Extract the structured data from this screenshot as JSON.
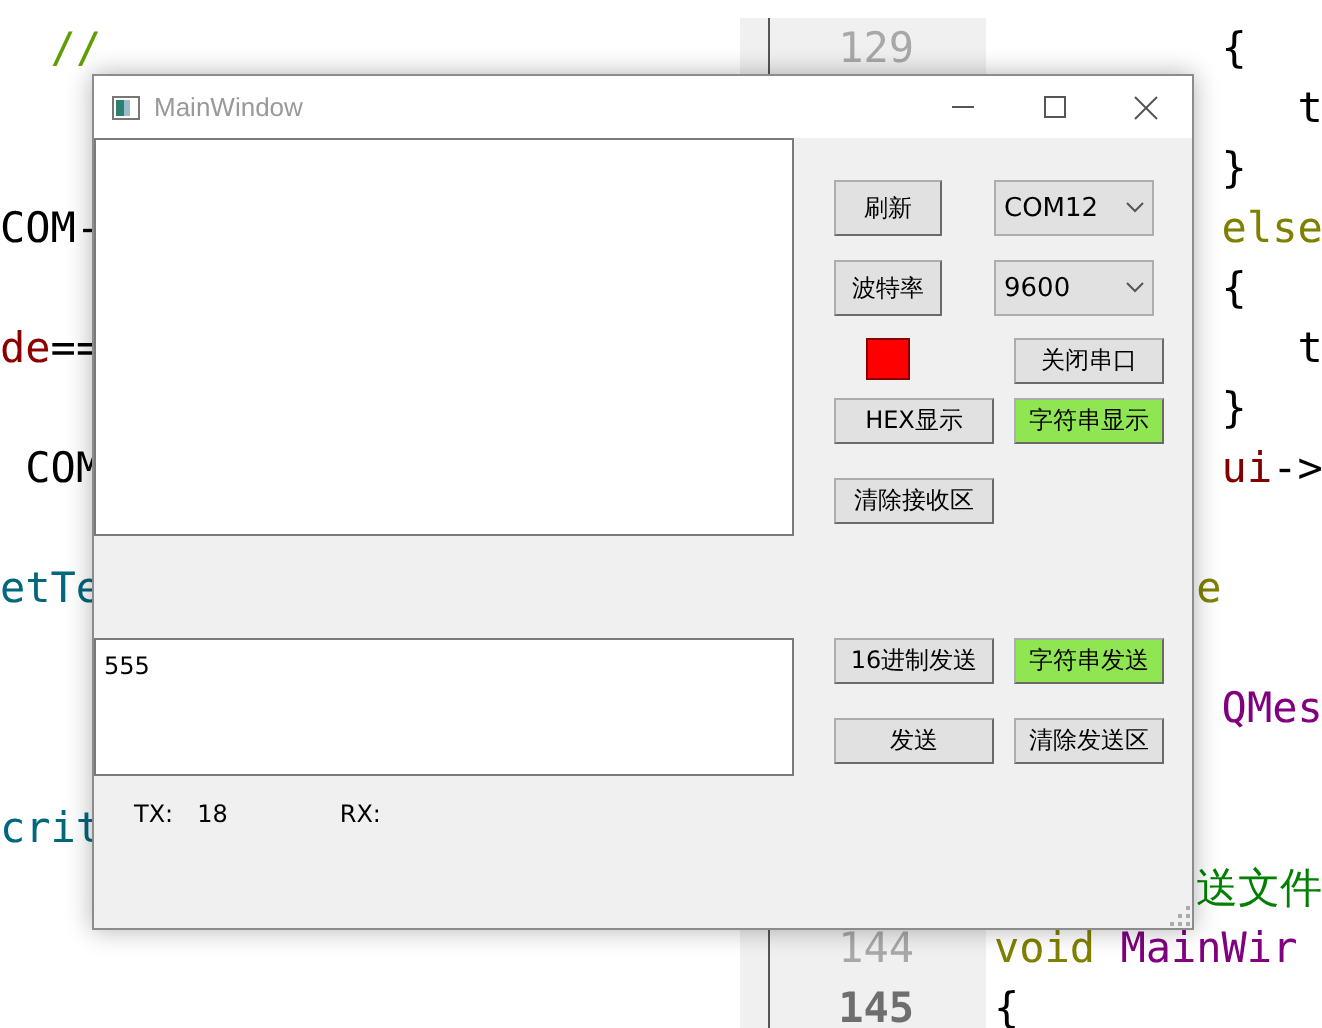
{
  "editor": {
    "lines": [
      {
        "left": [
          {
            "text": "  //",
            "color": "#5f9e00"
          }
        ],
        "number": "129",
        "current": false,
        "code": [
          {
            "text": "         {",
            "color": "#000000"
          }
        ]
      },
      {
        "code": [
          {
            "text": "            t",
            "color": "#000000"
          }
        ]
      },
      {
        "code": [
          {
            "text": "         }",
            "color": "#000000"
          }
        ]
      },
      {
        "left": [
          {
            "text": "COM-",
            "color": "#000000"
          }
        ],
        "code": [
          {
            "text": "         else",
            "color": "#808000"
          }
        ]
      },
      {
        "code": [
          {
            "text": "         {",
            "color": "#000000"
          }
        ]
      },
      {
        "left": [
          {
            "text": "de",
            "color": "#8b0000"
          },
          {
            "text": "==",
            "color": "#000000"
          }
        ],
        "code": [
          {
            "text": "            t",
            "color": "#000000"
          }
        ]
      },
      {
        "code": [
          {
            "text": "         }",
            "color": "#000000"
          }
        ]
      },
      {
        "left": [
          {
            "text": " COM",
            "color": "#000000"
          }
        ],
        "code": [
          {
            "text": "         ui",
            "color": "#800000"
          },
          {
            "text": "->",
            "color": "#000000"
          }
        ]
      },
      {
        "gap_before": true,
        "left": [
          {
            "text": "etTe",
            "color": "#00677c"
          }
        ],
        "code": [
          {
            "text": "        e",
            "color": "#808000"
          }
        ]
      },
      {
        "gap_before": true,
        "code": [
          {
            "text": "         QMes",
            "color": "#800080"
          }
        ]
      },
      {
        "gap_before": true,
        "left": [
          {
            "text": "crit",
            "color": "#00677c"
          }
        ]
      },
      {
        "code": [
          {
            "text": "        送文件",
            "color": "#008000"
          }
        ]
      },
      {
        "number": "144",
        "current": false,
        "code": [
          {
            "text": "void",
            "color": "#808000"
          },
          {
            "text": " MainWir",
            "color": "#800080"
          }
        ]
      },
      {
        "number": "145",
        "current": true,
        "code": [
          {
            "text": "{",
            "color": "#000000"
          }
        ]
      }
    ]
  },
  "window": {
    "title": "MainWindow",
    "send_area": {
      "value": "555"
    },
    "controls": [
      {
        "kind": "button",
        "label": "刷新"
      },
      {
        "kind": "combo",
        "value": "COM12"
      },
      {
        "kind": "button",
        "label": "波特率"
      },
      {
        "kind": "combo",
        "value": "9600"
      },
      {
        "kind": "indicator",
        "color": "#ff0000"
      },
      {
        "kind": "button",
        "label": "关闭串口"
      },
      {
        "kind": "toggle",
        "label": "HEX显示",
        "selected": false
      },
      {
        "kind": "toggle",
        "label": "字符串显示",
        "selected": true
      },
      {
        "kind": "button",
        "label": "清除接收区"
      },
      {
        "kind": "toggle",
        "label": "16进制发送",
        "selected": false
      },
      {
        "kind": "toggle",
        "label": "字符串发送",
        "selected": true
      },
      {
        "kind": "button",
        "label": "发送"
      },
      {
        "kind": "button",
        "label": "清除发送区"
      }
    ],
    "status": {
      "tx_label": "TX:",
      "tx_value": "18",
      "rx_label": "RX:"
    }
  }
}
